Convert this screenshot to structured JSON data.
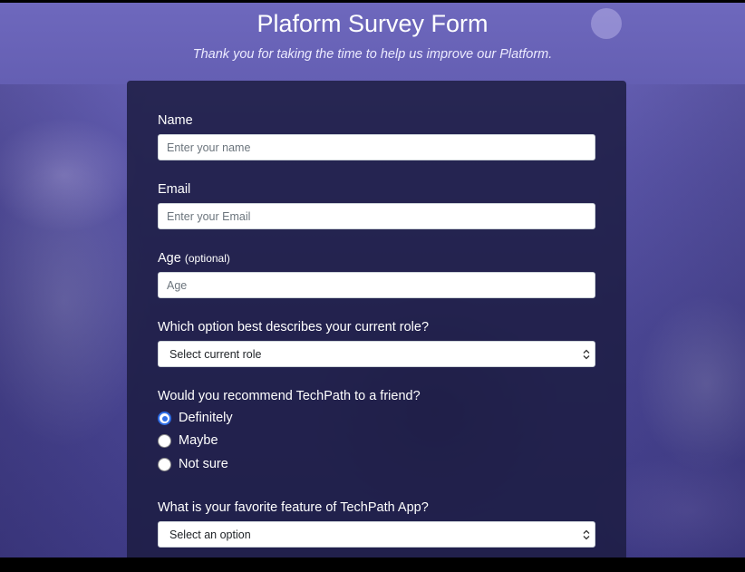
{
  "header": {
    "title": "Plaform Survey Form",
    "description": "Thank you for taking the time to help us improve our Platform."
  },
  "form": {
    "name": {
      "label": "Name",
      "placeholder": "Enter your name"
    },
    "email": {
      "label": "Email",
      "placeholder": "Enter your Email"
    },
    "age": {
      "label": "Age",
      "optional_note": "(optional)",
      "placeholder": "Age"
    },
    "role": {
      "label": "Which option best describes your current role?",
      "selected": "Select current role"
    },
    "recommend": {
      "label": "Would you recommend TechPath to a friend?",
      "options": [
        "Definitely",
        "Maybe",
        "Not sure"
      ],
      "checked": "Definitely"
    },
    "favorite_feature": {
      "label": "What is your favorite feature of TechPath App?",
      "selected": "Select an option"
    }
  },
  "colors": {
    "background_accent": "#5a55a8",
    "card_background": "#1b1c40",
    "radio_checked": "#2f6fe8",
    "text_primary": "#ffffff"
  },
  "icons": {
    "select_arrow": "chevron-updown-icon"
  }
}
